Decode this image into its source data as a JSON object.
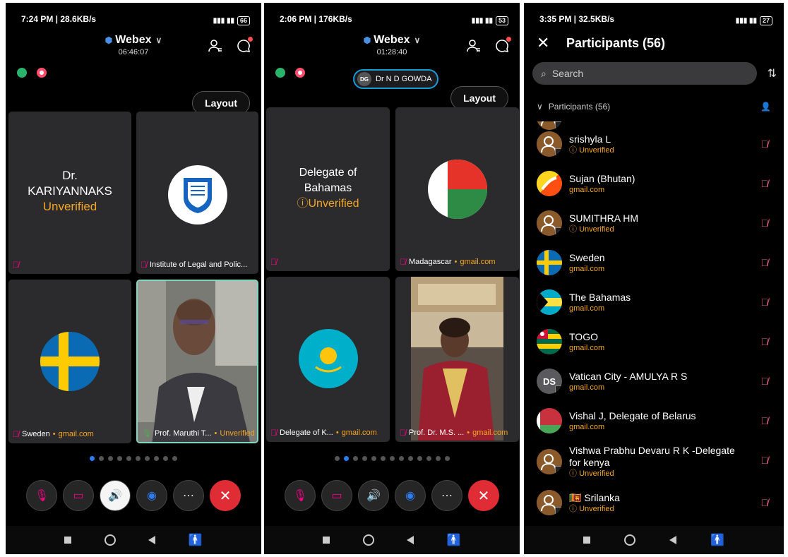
{
  "panel1": {
    "status_left": "7:24 PM | 28.6KB/s",
    "battery": "66",
    "app_title": "Webex",
    "timer": "06:46:07",
    "layout_label": "Layout",
    "tiles": [
      {
        "center_line1": "Dr.",
        "center_line2": "KARIYANNAKS",
        "center_line3": "Unverified",
        "label": ""
      },
      {
        "label": "Institute of Legal and Polic...",
        "domain": ""
      },
      {
        "label": "Sweden",
        "domain": "gmail.com"
      },
      {
        "label": "Prof. Maruthi T...",
        "domain": "Unverified"
      }
    ],
    "pages": 10,
    "active_page": 0
  },
  "panel2": {
    "status_left": "2:06 PM | 176KB/s",
    "battery": "53",
    "app_title": "Webex",
    "timer": "01:28:40",
    "speaker_initials": "DG",
    "speaker_name": "Dr N D GOWDA",
    "layout_label": "Layout",
    "tiles": [
      {
        "center_line1": "Delegate of",
        "center_line2": "Bahamas",
        "center_line3": "Unverified",
        "label": ""
      },
      {
        "label": "Madagascar",
        "domain": "gmail.com"
      },
      {
        "label": "Delegate of K...",
        "domain": "gmail.com"
      },
      {
        "label": "Prof. Dr. M.S. ...",
        "domain": "gmail.com"
      }
    ],
    "pages": 13,
    "active_page": 1
  },
  "panel3": {
    "status_left": "3:35 PM | 32.5KB/s",
    "battery": "27",
    "title": "Participants (56)",
    "search_placeholder": "Search",
    "section_label": "Participants (56)",
    "participants": [
      {
        "name": "",
        "sub": "Unverified",
        "avatar": "person"
      },
      {
        "name": "srishyla L",
        "sub": "Unverified",
        "avatar": "person"
      },
      {
        "name": "Sujan (Bhutan)",
        "sub": "gmail.com",
        "avatar": "bhutan"
      },
      {
        "name": "SUMITHRA HM",
        "sub": "Unverified",
        "avatar": "person"
      },
      {
        "name": "Sweden",
        "sub": "gmail.com",
        "avatar": "sweden"
      },
      {
        "name": "The Bahamas",
        "sub": "gmail.com",
        "avatar": "bahamas"
      },
      {
        "name": "TOGO",
        "sub": "gmail.com",
        "avatar": "togo"
      },
      {
        "name": "Vatican City - AMULYA R S",
        "sub": "gmail.com",
        "avatar": "initials",
        "initials": "DS"
      },
      {
        "name": "Vishal J, Delegate of Belarus",
        "sub": "gmail.com",
        "avatar": "belarus"
      },
      {
        "name": "Vishwa Prabhu Devaru R K -Delegate for kenya",
        "sub": "Unverified",
        "avatar": "person"
      },
      {
        "name": "🇱🇰 Srilanka",
        "sub": "Unverified",
        "avatar": "person"
      }
    ]
  },
  "colors": {
    "accent": "#f5a623",
    "end_call": "#e02d35",
    "active_dot": "#2d7df6",
    "tile_bg": "#2b2b2d"
  }
}
